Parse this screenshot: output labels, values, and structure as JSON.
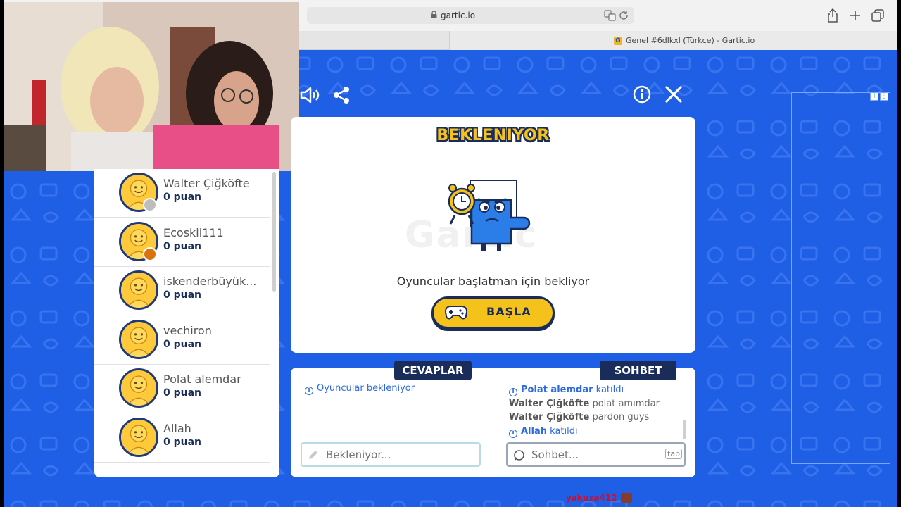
{
  "browser": {
    "url": "gartic.io",
    "tab_title": "Genel #6dlkxl (Türkçe) - Gartic.io",
    "tab_favicon_letter": "G"
  },
  "game": {
    "status_title": "BEKLENIYOR",
    "waiting_message": "Oyuncular başlatman için bekliyor",
    "start_button_label": "BAŞLA",
    "answers_title": "CEVAPLAR",
    "chat_title": "SOHBET",
    "answers_info": "Oyuncular bekleniyor",
    "answer_placeholder": "Bekleniyor...",
    "chat_placeholder": "Sohbet...",
    "chat_tab_hint": "tab",
    "watermark": "Gartic"
  },
  "players": [
    {
      "name": "Walter Çiğköfte",
      "score": "0 puan",
      "status_color": "#bdbdbd"
    },
    {
      "name": "Ecoskii111",
      "score": "0 puan",
      "status_color": "#d9730d"
    },
    {
      "name": "iskenderbüyük...",
      "score": "0 puan"
    },
    {
      "name": "vechiron",
      "score": "0 puan"
    },
    {
      "name": "Polat alemdar",
      "score": "0 puan"
    },
    {
      "name": "Allah",
      "score": "0 puan"
    }
  ],
  "chat": [
    {
      "user": "Polat alemdar",
      "text": "katıldı",
      "system": true
    },
    {
      "user": "Walter Çiğköfte",
      "text": "polat amımdar",
      "system": false
    },
    {
      "user": "Walter Çiğköfte",
      "text": "pardon guys",
      "system": false
    },
    {
      "user": "Allah",
      "text": "katıldı",
      "system": true
    }
  ],
  "stream_overlay": {
    "text": "yakuza412 :"
  },
  "colors": {
    "game_blue": "#1e5fe6",
    "navy": "#1a2d5a",
    "yellow": "#f5c21b",
    "link_blue": "#2c6ae0"
  },
  "icons": [
    "lock-icon",
    "translate-icon",
    "reload-icon",
    "share-icon",
    "plus-icon",
    "tabs-icon",
    "speaker-icon",
    "share-game-icon",
    "info-icon",
    "close-icon",
    "gamepad-icon",
    "pencil-icon",
    "search-icon"
  ]
}
